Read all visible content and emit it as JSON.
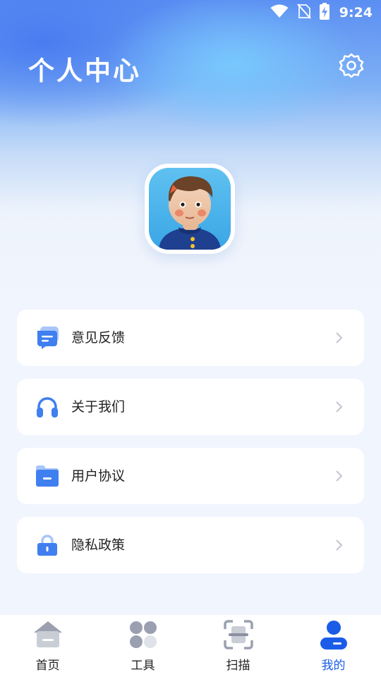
{
  "status_bar": {
    "time": "9:24"
  },
  "header": {
    "title": "个人中心"
  },
  "menu": [
    {
      "label": "意见反馈",
      "icon": "feedback-icon"
    },
    {
      "label": "关于我们",
      "icon": "headphones-icon"
    },
    {
      "label": "用户协议",
      "icon": "folder-icon"
    },
    {
      "label": "隐私政策",
      "icon": "lock-icon"
    }
  ],
  "tabs": [
    {
      "label": "首页",
      "icon": "home-icon",
      "active": false
    },
    {
      "label": "工具",
      "icon": "grid-icon",
      "active": false
    },
    {
      "label": "扫描",
      "icon": "scan-icon",
      "active": false
    },
    {
      "label": "我的",
      "icon": "user-icon",
      "active": true
    }
  ],
  "colors": {
    "accent": "#1a5ce8",
    "icon_blue": "#3f7ff0",
    "tab_gray": "#9aa0b0"
  }
}
